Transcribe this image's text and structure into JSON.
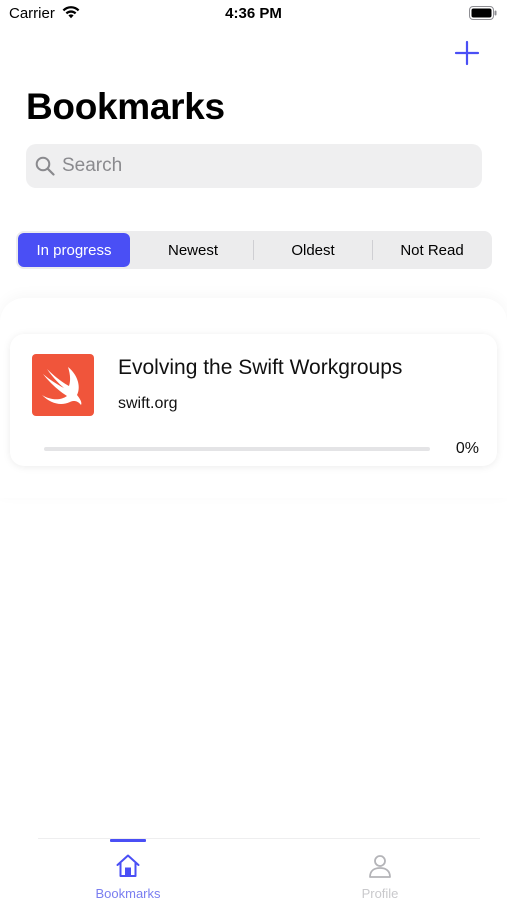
{
  "status_bar": {
    "carrier": "Carrier",
    "time": "4:36 PM"
  },
  "header": {
    "title": "Bookmarks"
  },
  "search": {
    "placeholder": "Search"
  },
  "filters": [
    {
      "label": "In progress",
      "selected": true
    },
    {
      "label": "Newest",
      "selected": false
    },
    {
      "label": "Oldest",
      "selected": false
    },
    {
      "label": "Not Read",
      "selected": false
    }
  ],
  "bookmarks": [
    {
      "title": "Evolving the Swift Workgroups",
      "domain": "swift.org",
      "progress_text": "0%",
      "progress": 0,
      "icon": "swift-logo-icon"
    }
  ],
  "tab_bar": {
    "items": [
      {
        "label": "Bookmarks",
        "icon": "home-icon",
        "active": true
      },
      {
        "label": "Profile",
        "icon": "person-icon",
        "active": false
      }
    ]
  },
  "colors": {
    "accent": "#4a4ff5",
    "swift_orange": "#f0553b"
  }
}
